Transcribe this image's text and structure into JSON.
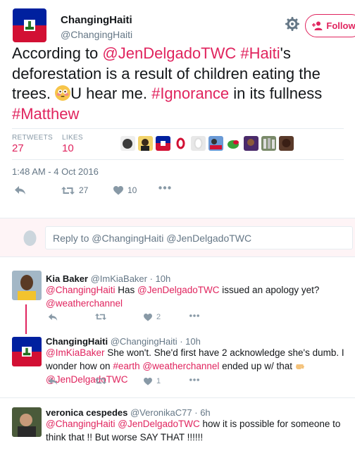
{
  "tweet": {
    "author_name": "ChangingHaiti",
    "author_handle": "@ChangingHaiti",
    "follow_label": "Follow",
    "text_parts": {
      "t1": "According to ",
      "m1": "@JenDelgadoTWC",
      "t2": " ",
      "h1": "#Haiti",
      "t3": "'s deforestation is a result of children eating the trees. ",
      "t4": "U hear me. ",
      "h2": "#Ignorance",
      "t5": " in its fullness ",
      "h3": "#Matthew"
    },
    "retweets_label": "RETWEETS",
    "retweets_count": "27",
    "likes_label": "LIKES",
    "likes_count": "10",
    "timestamp": "1:48 AM - 4 Oct 2016",
    "action_retweet_count": "27",
    "action_like_count": "10"
  },
  "reply_box": {
    "placeholder": "Reply to @ChangingHaiti @JenDelgadoTWC"
  },
  "replies": [
    {
      "name": "Kia Baker",
      "handle": "@ImKiaBaker",
      "time": "· 10h",
      "parts": {
        "m1": "@ChangingHaiti",
        "t1": " Has ",
        "m2": "@JenDelgadoTWC",
        "t2": " issued an apology yet?",
        "m3": "@weatherchannel"
      },
      "like_count": "2"
    },
    {
      "name": "ChangingHaiti",
      "handle": "@ChangingHaiti",
      "time": "· 10h",
      "parts": {
        "m1": "@ImKiaBaker",
        "t1": " She won't. She'd first have 2 acknowledge she's dumb. I wonder how on ",
        "h1": "#earth",
        "t2": " ",
        "m2": "@weatherchannel",
        "t3": " ended up w/ that ",
        "m3": "@JenDelgadoTWC"
      },
      "like_count": "1"
    },
    {
      "name": "veronica cespedes",
      "handle": "@VeronikaC77",
      "time": "· 6h",
      "parts": {
        "m1": "@ChangingHaiti",
        "t1": " ",
        "m2": "@JenDelgadoTWC",
        "t2": " how it is possible for someone to think that !! But worse SAY THAT !!!!!!"
      }
    }
  ],
  "icons": {
    "gear": "gear-icon",
    "follow": "add-user-icon",
    "reply": "reply-icon",
    "retweet": "retweet-icon",
    "like": "heart-icon",
    "more": "more-icon"
  },
  "colors": {
    "accent": "#e0245e",
    "muted": "#657786",
    "reply_bg": "#fef4f6"
  }
}
